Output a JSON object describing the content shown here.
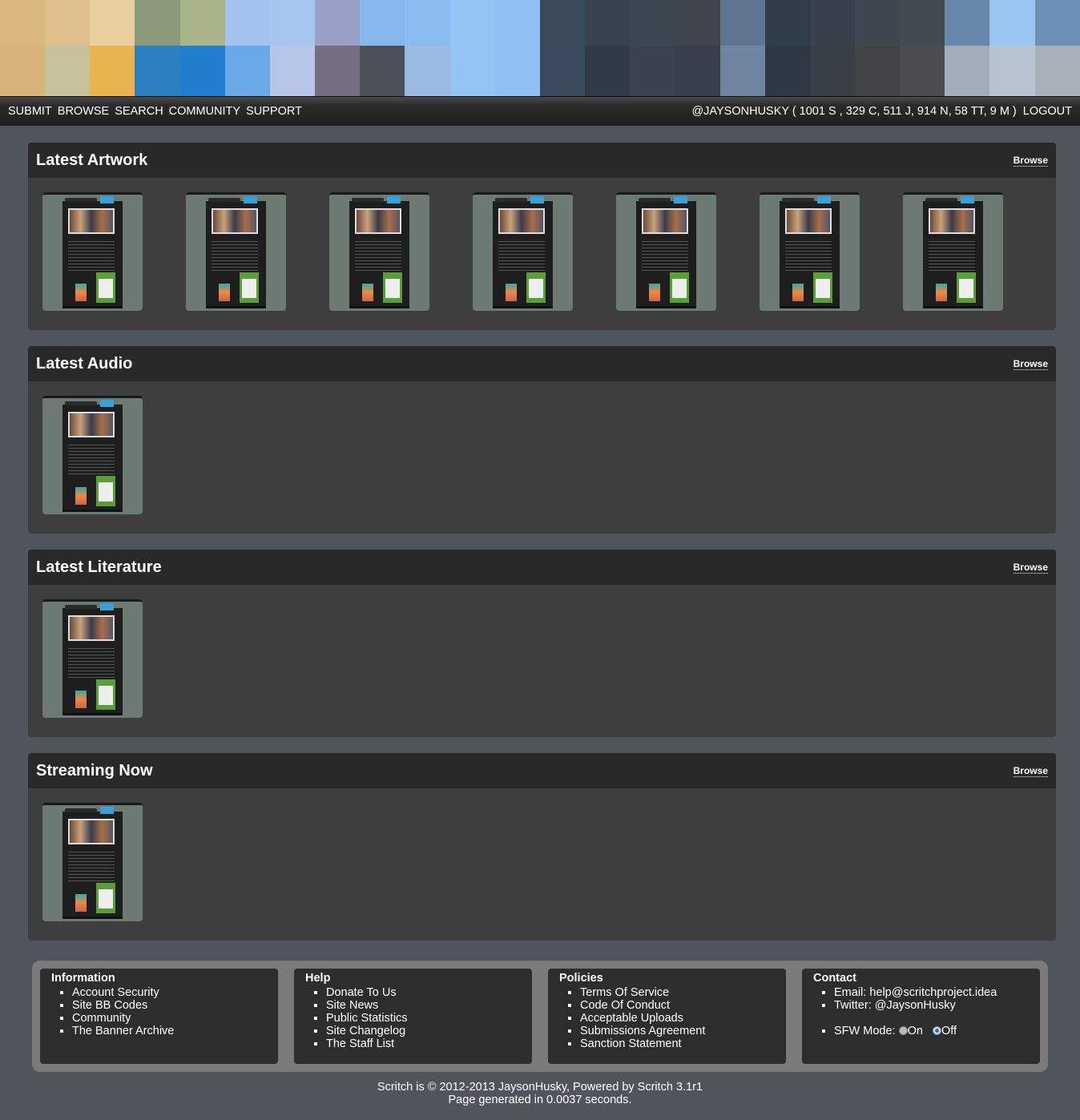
{
  "banner": {
    "pixel_colors": [
      "#d9b77d",
      "#e0c08e",
      "#e8cfa0",
      "#8a9a7a",
      "#a9b48a",
      "#a3c3ef",
      "#a6c6f0",
      "#9aa0c8",
      "#87b7ee",
      "#8abcf1",
      "#93c4f4",
      "#8fc0f5",
      "#3b4a5a",
      "#38434f",
      "#3c4650",
      "#40444c",
      "#5f7692",
      "#323d4a",
      "#38414c",
      "#3f4650",
      "#444a52",
      "#6788aa",
      "#9cc6f2",
      "#6c8fb5",
      "#d7b47c",
      "#c7c29c",
      "#eab54e",
      "#2e7fc0",
      "#227fd0",
      "#69a9e8",
      "#b7c6e6",
      "#746f80",
      "#4c5058",
      "#9ab9e3",
      "#93c4f4",
      "#8fc0f5",
      "#3a4a5c",
      "#2f3a46",
      "#39424d",
      "#37404a",
      "#7085a1",
      "#2f3945",
      "#3a3f46",
      "#414345",
      "#4a4c50",
      "#a2adbb",
      "#b6c4d2",
      "#a8b0ba"
    ]
  },
  "nav": {
    "items": [
      "SUBMIT",
      "BROWSE",
      "SEARCH",
      "COMMUNITY",
      "SUPPORT"
    ],
    "user": "@JAYSONHUSKY ( 1001 S , 329 C, 511 J, 914 N, 58 TT, 9 M )",
    "logout": "LOGOUT"
  },
  "sections": [
    {
      "title": "Latest Artwork",
      "browse": "Browse",
      "count": 7
    },
    {
      "title": "Latest Audio",
      "browse": "Browse",
      "count": 1
    },
    {
      "title": "Latest Literature",
      "browse": "Browse",
      "count": 1
    },
    {
      "title": "Streaming Now",
      "browse": "Browse",
      "count": 1
    }
  ],
  "footer": {
    "information": {
      "title": "Information",
      "items": [
        "Account Security",
        "Site BB Codes",
        "Community",
        "The Banner Archive"
      ]
    },
    "help": {
      "title": "Help",
      "items": [
        "Donate To Us",
        "Site News",
        "Public Statistics",
        "Site Changelog",
        "The Staff List"
      ]
    },
    "policies": {
      "title": "Policies",
      "items": [
        "Terms Of Service",
        "Code Of Conduct",
        "Acceptable Uploads",
        "Submissions Agreement",
        "Sanction Statement"
      ]
    },
    "contact": {
      "title": "Contact",
      "email": "Email: help@scritchproject.idea",
      "twitter": "Twitter: @JaysonHusky",
      "sfw_label": "SFW Mode:",
      "sfw_on": "On",
      "sfw_off": "Off",
      "sfw_selected": "Off"
    }
  },
  "credits": {
    "line1": "Scritch is © 2012-2013 JaysonHusky, Powered by Scritch 3.1r1",
    "line2": "Page generated in 0.0037 seconds."
  }
}
